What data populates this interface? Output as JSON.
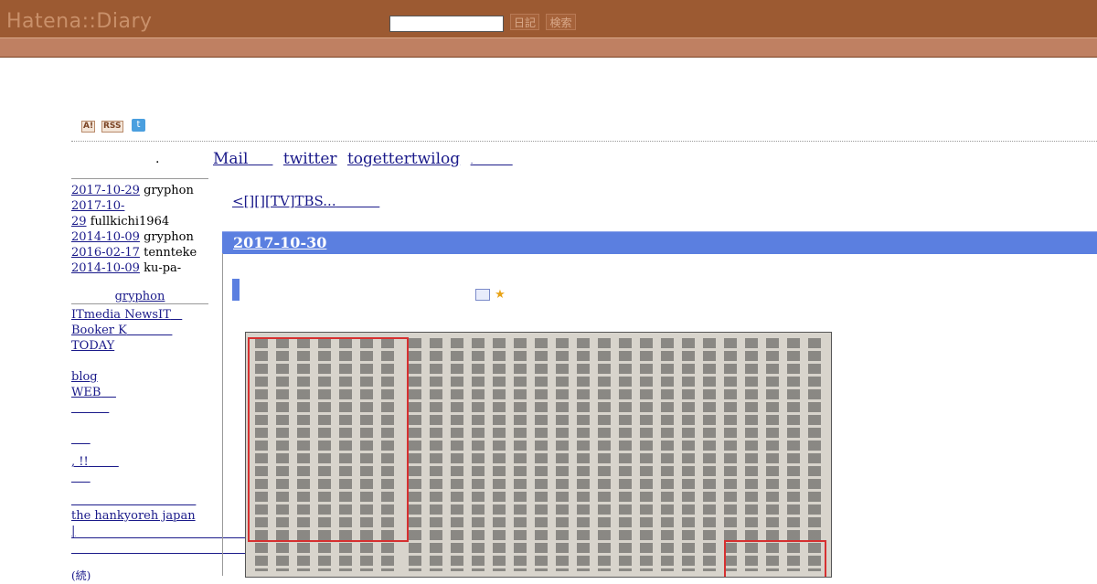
{
  "header": {
    "logo": "Hatena::Diary",
    "search_placeholder": "",
    "btn_diary": "日記",
    "btn_search": "検索"
  },
  "icons": {
    "ai": "A!",
    "rss": "RSS",
    "twitter": "t"
  },
  "sidebar": {
    "dot": ".",
    "comments": [
      {
        "date": "2017-10-29",
        "user": "gryphon"
      },
      {
        "date_a": "2017-10-",
        "date_b": "29",
        "user": "fullkichi1964"
      },
      {
        "date": "2014-10-09",
        "user": "gryphon"
      },
      {
        "date": "2016-02-17",
        "user": "tennteke"
      },
      {
        "date": "2014-10-09",
        "user": "ku-pa-"
      }
    ],
    "profile_link": "gryphon",
    "links": [
      "ITmedia NewsIT",
      "Booker K",
      "TODAY",
      "",
      "blog",
      "WEB"
    ],
    "link_hankyoreh": "the hankyoreh japan",
    "link_bang": ", !!",
    "link_pipe": "|"
  },
  "topnav": {
    "mail": "Mail",
    "twitter": "twitter",
    "togetter": "togettertwilog",
    "sep": "."
  },
  "crumb": {
    "prev": "<[][][TV]TBS..."
  },
  "day": {
    "date": "2017-10-30"
  },
  "colors": {
    "header": "#9c5a32",
    "subbar": "#bf8062",
    "daybar": "#5b7fe0",
    "link": "#1a1a8a",
    "scan_highlight": "#d63030"
  }
}
